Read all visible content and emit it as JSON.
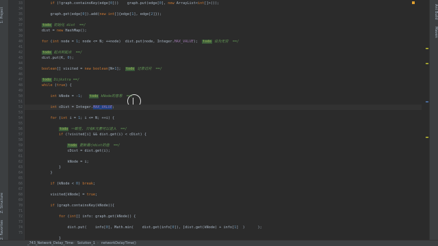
{
  "sidebar_left": {
    "project_label": "1: Project",
    "structure_label": "Z: Structure",
    "favorites_label": "2: Favorites"
  },
  "sidebar_right": {
    "ant_build_label": "Ant Build",
    "maven_label": "Maven"
  },
  "editor": {
    "line_numbers": [
      "33",
      "34",
      "35",
      "36",
      "37",
      "38",
      "39",
      "40",
      "41",
      "42",
      "43",
      "44",
      "45",
      "46",
      "47",
      "48",
      "49",
      "50",
      "51",
      "52",
      "53",
      "54",
      "55",
      "56",
      "57",
      "58",
      "59",
      "60",
      "61",
      "62",
      "63",
      "64",
      "65",
      "66",
      "67",
      "68",
      "69",
      "70",
      "71",
      "72",
      "73",
      "74",
      "75"
    ],
    "current_line": "52",
    "lines": [
      "            if (!graph.containsKey(edge[0]))    graph.put(edge[0], new ArrayList<int[]>());",
      "",
      "            graph.get(edge[0]).add(new int[]{edge[1], edge[2]});",
      "",
      "        todo 初始化 dist  ==/",
      "        dist = new HashMap();",
      "",
      "        for (int node = 1; node <= N; ++node)  dist.put(node, Integer.MAX_VALUE);  todo 设为无穷  ==/",
      "",
      "        todo 起点到起点  ==/",
      "        dist.put(K, 0);",
      "",
      "        boolean[] visited = new boolean[N+1];  todo 记录访问  ==/",
      "",
      "        todo Dijkstra ==/",
      "        while (true) {",
      "",
      "            int kNode = -1;   todo kNode的意思  ==/",
      "",
      "            int cDist = Integer.MAX_VALUE;",
      "",
      "            for (int i = 1; i <= N; ++i) {",
      "",
      "                todo 一致性, 只有K元素可以进入  ==/",
      "                if (!visited[i] && dist.get(i) < cDist) {",
      "",
      "                    todo 更新最小dist的值  ==/",
      "                    cDist = dist.get(i);",
      "",
      "                    kNode = i;",
      "                }",
      "            }",
      "",
      "            if (kNode < 0) break;",
      "",
      "            visited[kNode] = true;",
      "",
      "            if (graph.containsKey(kNode)){",
      "",
      "                for (int[] info: graph.get(kNode)) {",
      "",
      "                    dist.put(    info[0], Math.min(    dist.get(info[0]), [dist.get(kNode) + info[1]  )      );",
      "",
      "                }"
    ]
  },
  "breadcrumb": {
    "file": "_743_Network_Delay_Time",
    "class": "Solution_1",
    "method": "networkDelayTime()"
  },
  "colors": {
    "background": "#2b2b2b",
    "keyword": "#cc7832",
    "number": "#6897bb",
    "comment": "#629755",
    "selection": "#214283"
  }
}
